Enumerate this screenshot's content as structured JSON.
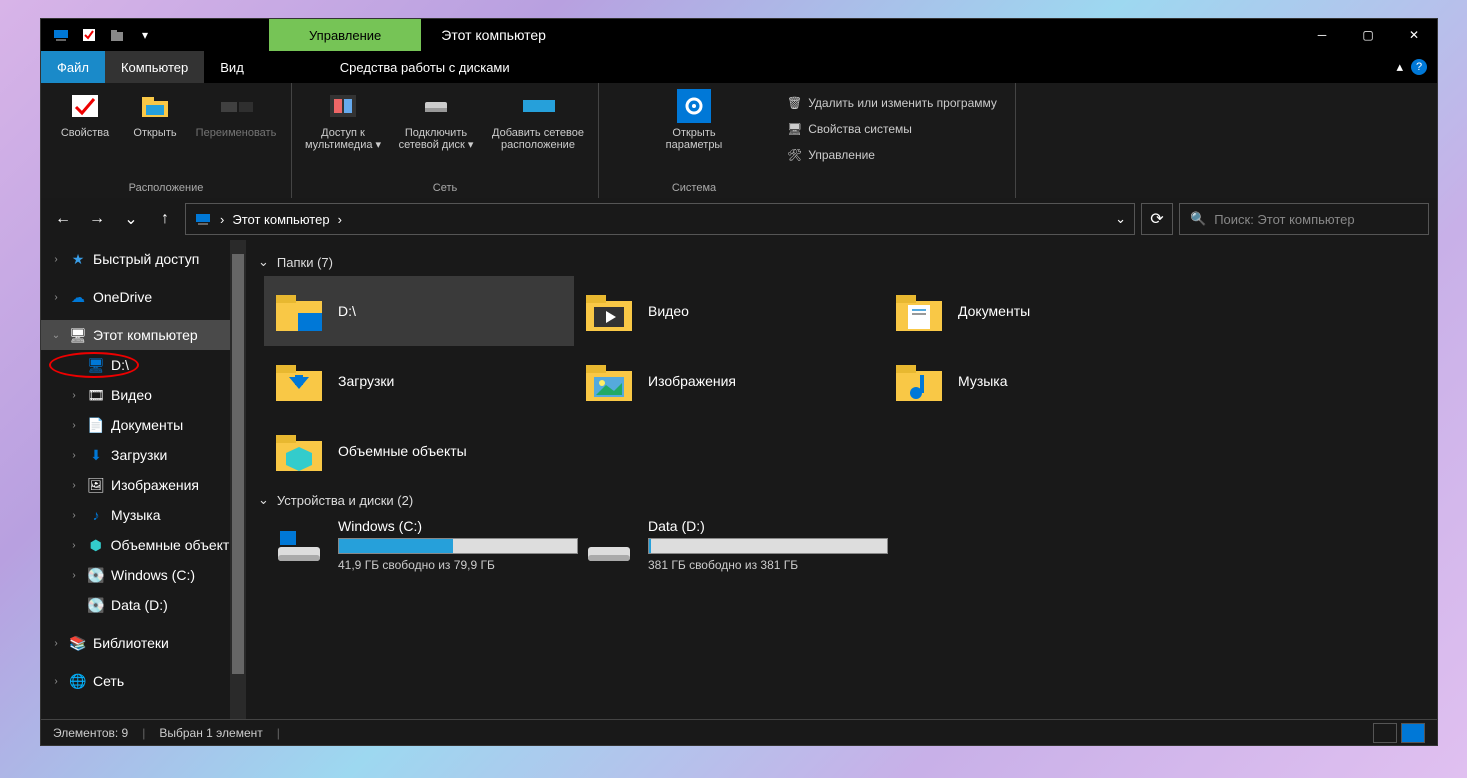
{
  "title": "Этот компьютер",
  "titlebar": {
    "manage": "Управление"
  },
  "tabs": {
    "file": "Файл",
    "computer": "Компьютер",
    "view": "Вид",
    "tools": "Средства работы с дисками"
  },
  "ribbon": {
    "location": {
      "properties": "Свойства",
      "open": "Открыть",
      "rename": "Переименовать",
      "group": "Расположение"
    },
    "network": {
      "media": "Доступ к мультимедиа",
      "mapdrive": "Подключить сетевой диск",
      "addloc": "Добавить сетевое расположение",
      "group": "Сеть"
    },
    "system": {
      "settings": "Открыть параметры",
      "uninstall": "Удалить или изменить программу",
      "sysprops": "Свойства системы",
      "manage": "Управление",
      "group": "Система"
    }
  },
  "nav": {
    "path": "Этот компьютер"
  },
  "search": {
    "placeholder": "Поиск: Этот компьютер"
  },
  "sidebar": {
    "quick": "Быстрый доступ",
    "onedrive": "OneDrive",
    "thispc": "Этот компьютер",
    "items": [
      {
        "label": "D:\\"
      },
      {
        "label": "Видео"
      },
      {
        "label": "Документы"
      },
      {
        "label": "Загрузки"
      },
      {
        "label": "Изображения"
      },
      {
        "label": "Музыка"
      },
      {
        "label": "Объемные объекты"
      },
      {
        "label": "Windows (C:)"
      },
      {
        "label": "Data (D:)"
      }
    ],
    "libraries": "Библиотеки",
    "network": "Сеть"
  },
  "content": {
    "folders_header": "Папки (7)",
    "folders": [
      {
        "label": "D:\\"
      },
      {
        "label": "Видео"
      },
      {
        "label": "Документы"
      },
      {
        "label": "Загрузки"
      },
      {
        "label": "Изображения"
      },
      {
        "label": "Музыка"
      },
      {
        "label": "Объемные объекты"
      }
    ],
    "drives_header": "Устройства и диски (2)",
    "drives": [
      {
        "name": "Windows (C:)",
        "free": "41,9 ГБ свободно из 79,9 ГБ",
        "pct": 48
      },
      {
        "name": "Data (D:)",
        "free": "381 ГБ свободно из 381 ГБ",
        "pct": 1
      }
    ]
  },
  "status": {
    "count": "Элементов: 9",
    "selected": "Выбран 1 элемент"
  }
}
